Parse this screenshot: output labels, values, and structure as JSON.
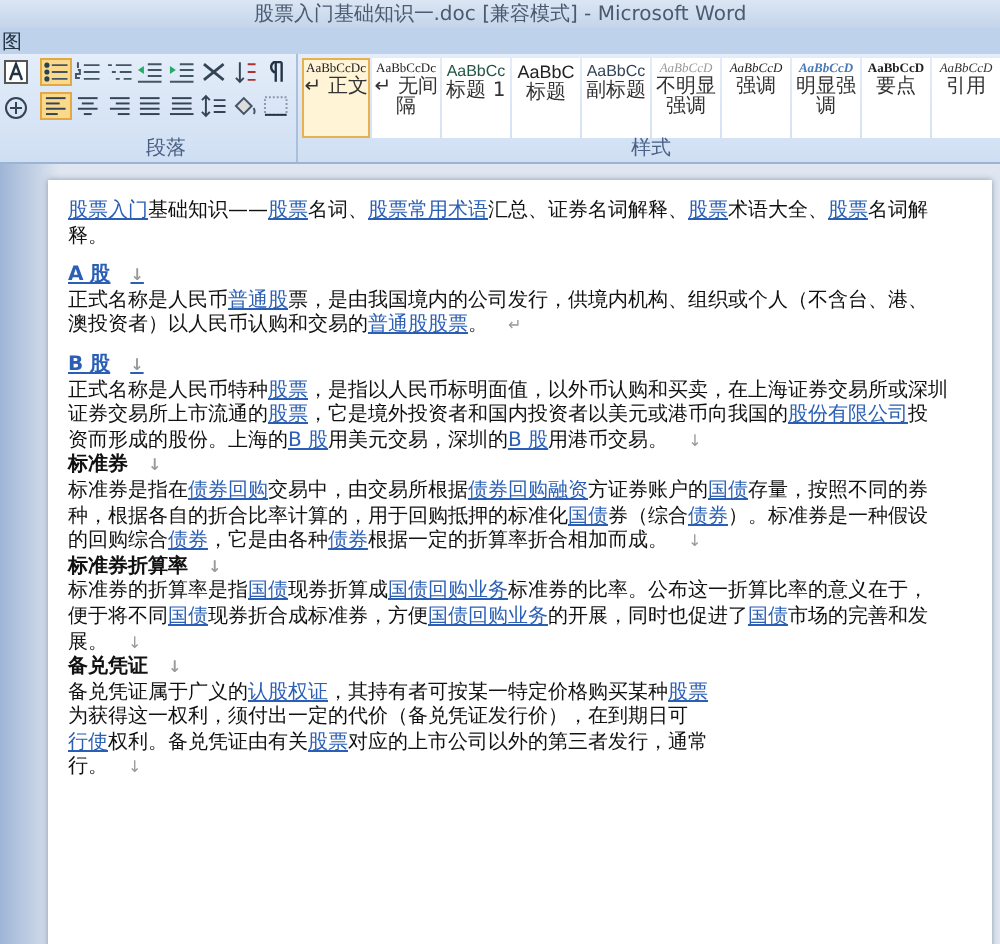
{
  "window": {
    "title": "股票入门基础知识一.doc [兼容模式] - Microsoft Word"
  },
  "ribbon": {
    "tab_fragment": "图",
    "paragraph_group": {
      "label": "段落",
      "alignments": [
        {
          "kind": "left",
          "selected": true
        },
        {
          "kind": "center",
          "selected": false
        },
        {
          "kind": "right",
          "selected": false
        },
        {
          "kind": "justify",
          "selected": false
        },
        {
          "kind": "distribute",
          "selected": false
        }
      ]
    },
    "styles_group": {
      "label": "样式",
      "styles": [
        {
          "preview": "AaBbCcDc",
          "name": "↵ 正文",
          "kind": "normal",
          "selected": true
        },
        {
          "preview": "AaBbCcDc",
          "name": "↵ 无间隔",
          "kind": "normal",
          "selected": false
        },
        {
          "preview": "AaBbCc",
          "name": "标题 1",
          "kind": "heading",
          "selected": false
        },
        {
          "preview": "AaBbC",
          "name": "标题",
          "kind": "title",
          "selected": false
        },
        {
          "preview": "AaBbCc",
          "name": "副标题",
          "kind": "subtitle",
          "selected": false
        },
        {
          "preview": "AaBbCcD",
          "name": "不明显强调",
          "kind": "subtle",
          "selected": false
        },
        {
          "preview": "AaBbCcD",
          "name": "强调",
          "kind": "emphasis",
          "selected": false
        },
        {
          "preview": "AaBbCcD",
          "name": "明显强调",
          "kind": "intense",
          "selected": false
        },
        {
          "preview": "AaBbCcD",
          "name": "要点",
          "kind": "strong",
          "selected": false
        },
        {
          "preview": "AaBbCcD",
          "name": "引用",
          "kind": "quote",
          "selected": false
        }
      ]
    }
  },
  "document": {
    "paragraphs": [
      {
        "kind": "text",
        "lines": [
          [
            {
              "text": "股票入门",
              "link": true
            },
            {
              "text": "基础知识——",
              "link": false
            },
            {
              "text": "股票",
              "link": true
            },
            {
              "text": "名词、",
              "link": false
            },
            {
              "text": "股票常用术语",
              "link": true
            },
            {
              "text": "汇总、证券名词解释、",
              "link": false
            },
            {
              "text": "股票",
              "link": true
            },
            {
              "text": "术语大全、",
              "link": false
            },
            {
              "text": "股票",
              "link": true
            },
            {
              "text": "名词解",
              "link": false
            }
          ],
          [
            {
              "text": "释。",
              "link": false
            }
          ]
        ]
      },
      {
        "kind": "link-heading",
        "mark": "↓",
        "text": "A 股"
      },
      {
        "kind": "text",
        "mark": "↵",
        "lines": [
          [
            {
              "text": "正式名称是人民币",
              "link": false
            },
            {
              "text": "普通股",
              "link": true
            },
            {
              "text": "票，是由我国境内的公司发行，供境内机构、组织或个人（不含台、港、",
              "link": false
            }
          ],
          [
            {
              "text": "澳投资者）以人民币认购和交易的",
              "link": false
            },
            {
              "text": "普通股股票",
              "link": true
            },
            {
              "text": "。",
              "link": false
            }
          ]
        ]
      },
      {
        "kind": "link-heading",
        "mark": "↓",
        "text": "B 股"
      },
      {
        "kind": "text",
        "mark": "↓",
        "lines": [
          [
            {
              "text": "正式名称是人民币特种",
              "link": false
            },
            {
              "text": "股票",
              "link": true
            },
            {
              "text": "，是指以人民币标明面值，以外币认购和买卖，在上海证券交易所或深圳",
              "link": false
            }
          ],
          [
            {
              "text": "证券交易所上市流通的",
              "link": false
            },
            {
              "text": "股票",
              "link": true
            },
            {
              "text": "，它是境外投资者和国内投资者以美元或港币向我国的",
              "link": false
            },
            {
              "text": "股份有限公司",
              "link": true
            },
            {
              "text": "投",
              "link": false
            }
          ],
          [
            {
              "text": "资而形成的股份。上海的",
              "link": false
            },
            {
              "text": "B 股",
              "link": true
            },
            {
              "text": "用美元交易，深圳的",
              "link": false
            },
            {
              "text": "B 股",
              "link": true
            },
            {
              "text": "用港币交易。",
              "link": false
            }
          ]
        ]
      },
      {
        "kind": "heading",
        "mark": "↓",
        "text": "标准券"
      },
      {
        "kind": "text",
        "mark": "↓",
        "lines": [
          [
            {
              "text": "标准券是指在",
              "link": false
            },
            {
              "text": "债券回购",
              "link": true
            },
            {
              "text": "交易中，由交易所根据",
              "link": false
            },
            {
              "text": "债券回购融资",
              "link": true
            },
            {
              "text": "方证券账户的",
              "link": false
            },
            {
              "text": "国债",
              "link": true
            },
            {
              "text": "存量，按照不同的券",
              "link": false
            }
          ],
          [
            {
              "text": "种，根据各自的折合比率计算的，用于回购抵押的标准化",
              "link": false
            },
            {
              "text": "国债",
              "link": true
            },
            {
              "text": "券（综合",
              "link": false
            },
            {
              "text": "债券",
              "link": true
            },
            {
              "text": "）。标准券是一种假设",
              "link": false
            }
          ],
          [
            {
              "text": "的回购综合",
              "link": false
            },
            {
              "text": "债券",
              "link": true
            },
            {
              "text": "，它是由各种",
              "link": false
            },
            {
              "text": "债券",
              "link": true
            },
            {
              "text": "根据一定的折算率折合相加而成。",
              "link": false
            }
          ]
        ]
      },
      {
        "kind": "heading",
        "mark": "↓",
        "text": "标准券折算率"
      },
      {
        "kind": "text",
        "mark": "↓",
        "lines": [
          [
            {
              "text": "标准券的折算率是指",
              "link": false
            },
            {
              "text": "国债",
              "link": true
            },
            {
              "text": "现券折算成",
              "link": false
            },
            {
              "text": "国债回购业务",
              "link": true
            },
            {
              "text": "标准券的比率。公布这一折算比率的意义在于，",
              "link": false
            }
          ],
          [
            {
              "text": "便于将不同",
              "link": false
            },
            {
              "text": "国债",
              "link": true
            },
            {
              "text": "现券折合成标准券，方便",
              "link": false
            },
            {
              "text": "国债回购业务",
              "link": true
            },
            {
              "text": "的开展，同时也促进了",
              "link": false
            },
            {
              "text": "国债",
              "link": true
            },
            {
              "text": "市场的完善和发",
              "link": false
            }
          ],
          [
            {
              "text": "展。",
              "link": false
            }
          ]
        ]
      },
      {
        "kind": "heading",
        "mark": "↓",
        "text": "备兑凭证"
      },
      {
        "kind": "text",
        "mark": "↓",
        "lines": [
          [
            {
              "text": "备兑凭证属于广义的",
              "link": false
            },
            {
              "text": "认股权证",
              "link": true
            },
            {
              "text": "，其持有者可按某一特定价格购买某种",
              "link": false
            },
            {
              "text": "股票",
              "link": true
            }
          ],
          [
            {
              "text": "为获得这一权利，须付出一定的代价（备兑凭证发行价），在到期日可",
              "link": false
            }
          ],
          [
            {
              "text": "行使",
              "link": true
            },
            {
              "text": "权利。备兑凭证由有关",
              "link": false
            },
            {
              "text": "股票",
              "link": true
            },
            {
              "text": "对应的上市公司以外的第三者发行，通常",
              "link": false
            }
          ],
          [
            {
              "text": "行。",
              "link": false
            }
          ]
        ]
      }
    ]
  }
}
